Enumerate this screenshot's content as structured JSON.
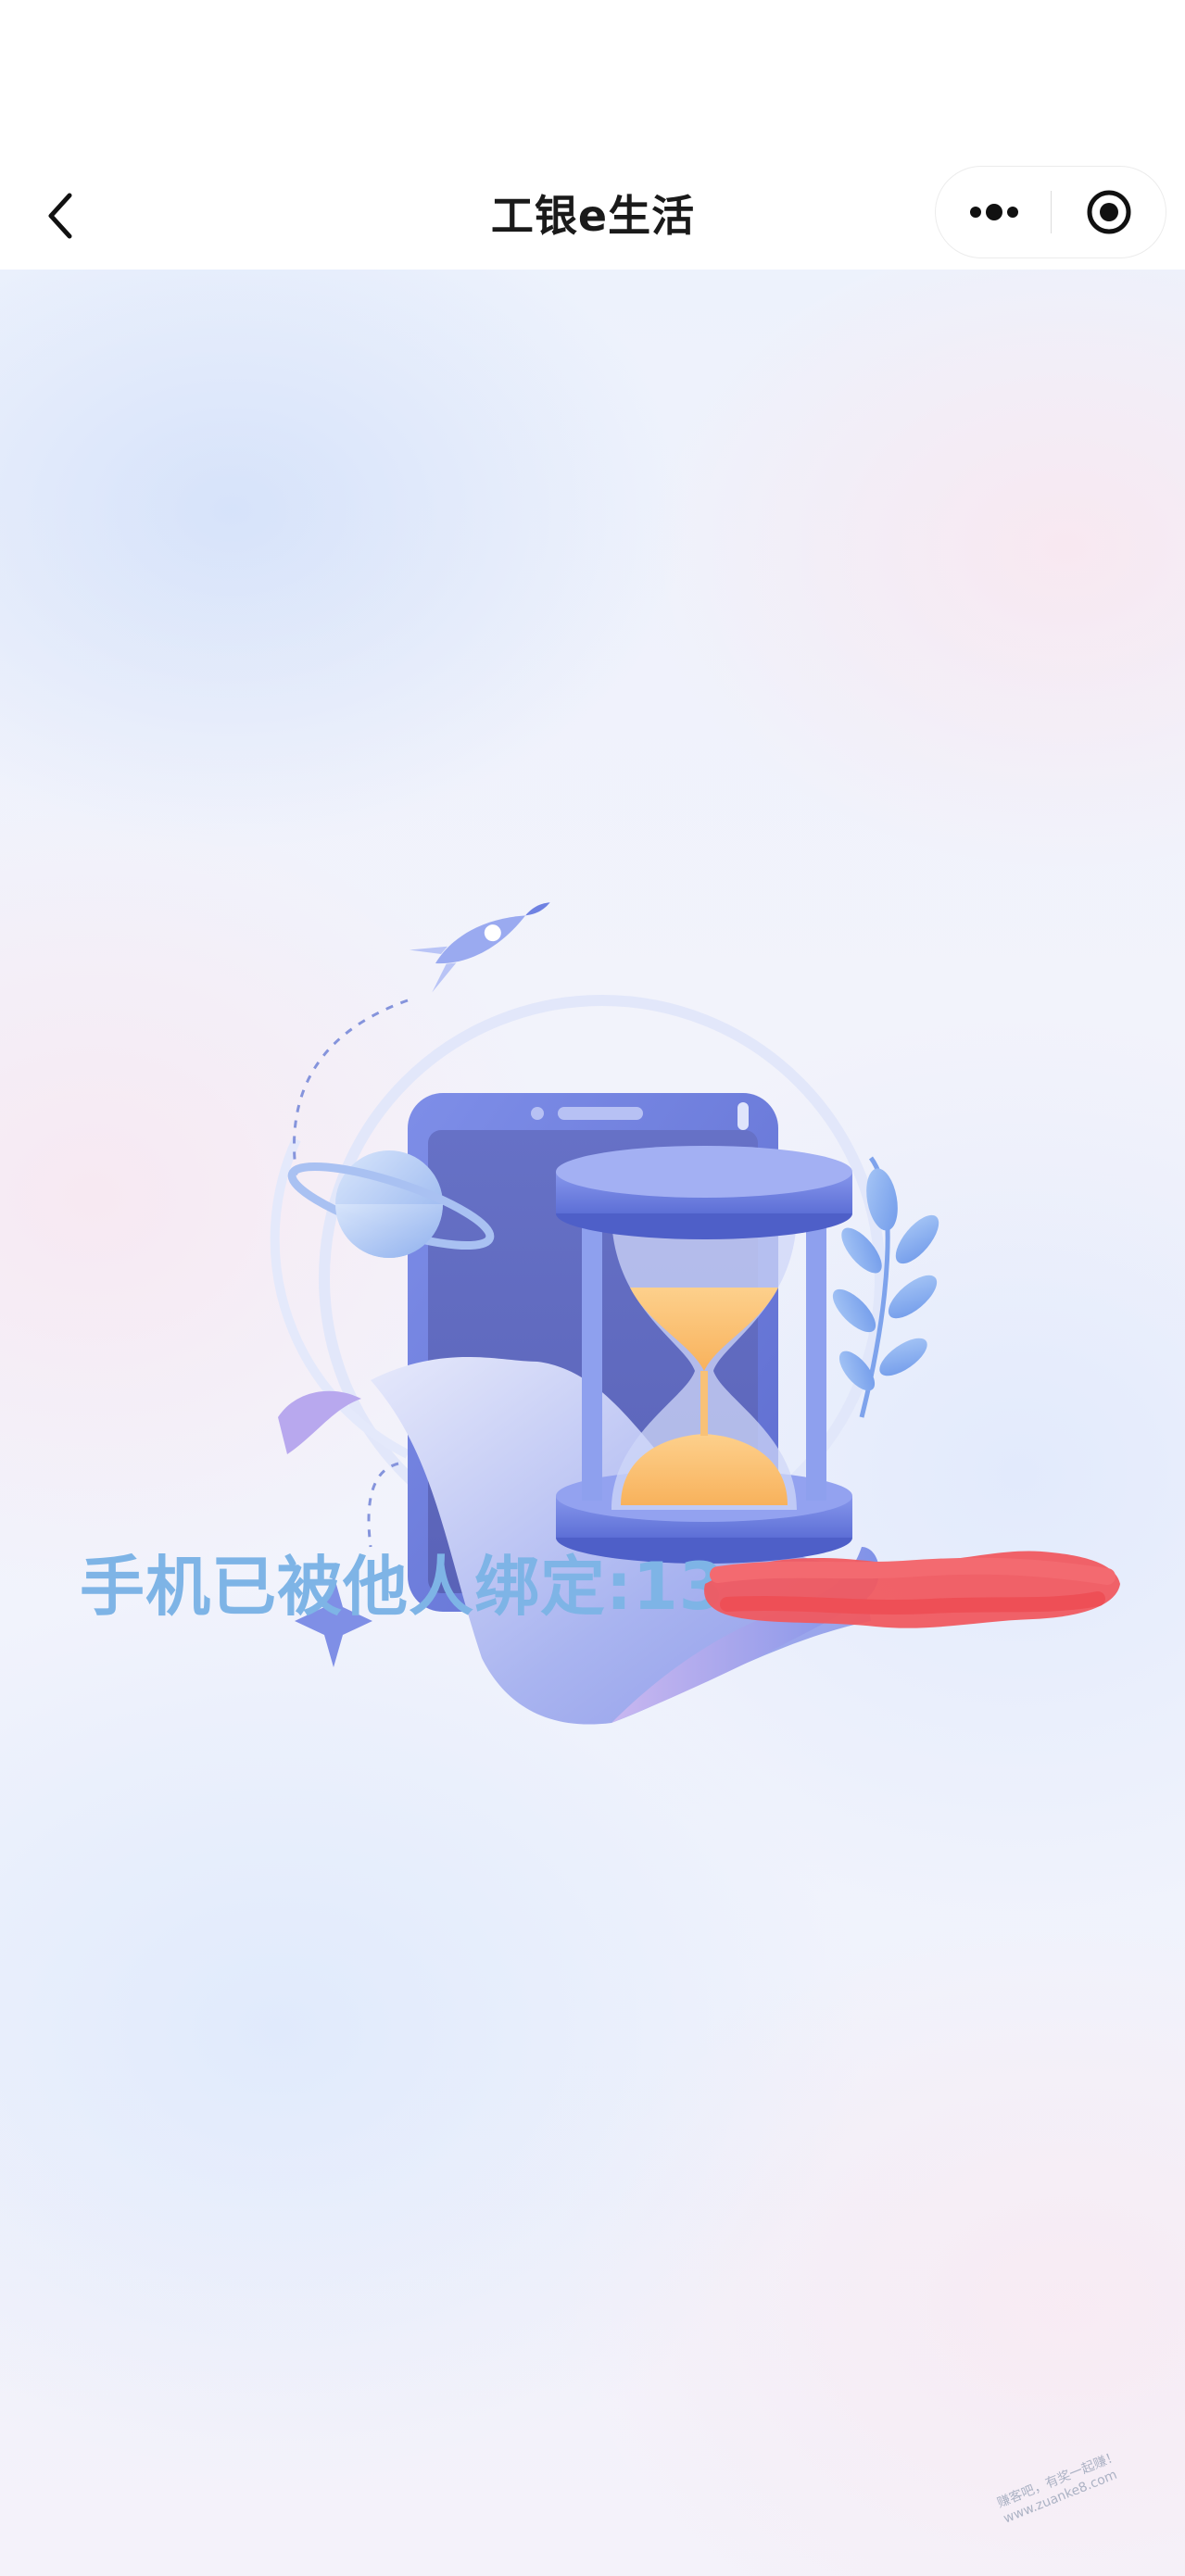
{
  "nav": {
    "title": "工银e生活"
  },
  "icons": {
    "back": "chevron-left-icon",
    "more": "more-dots-icon",
    "close": "target-close-icon"
  },
  "main": {
    "message_prefix": "手机已被他人绑定:",
    "phone_visible": "13"
  },
  "watermark": {
    "line1": "赚客吧，有奖一起赚！",
    "line2": "www.zuanke8.com"
  },
  "colors": {
    "message": "#7eb4e6",
    "redaction": "#f05a60",
    "hourglass_sand": "#fbbf74",
    "accent_blue": "#6b80e0"
  }
}
